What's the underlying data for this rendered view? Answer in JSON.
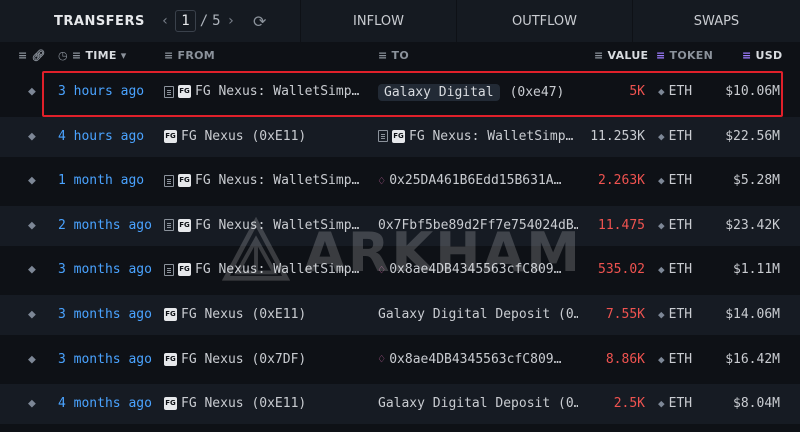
{
  "topbar": {
    "transfers_label": "TRANSFERS",
    "page_current": "1",
    "page_sep": "/",
    "page_total": "5",
    "tabs": [
      "INFLOW",
      "OUTFLOW",
      "SWAPS"
    ]
  },
  "header": {
    "time": "TIME",
    "from": "FROM",
    "to": "TO",
    "value": "VALUE",
    "token": "TOKEN",
    "usd": "USD"
  },
  "rows": [
    {
      "time": "3 hours ago",
      "from_icon": "doc",
      "from": "FG Nexus: WalletSimp…",
      "to_icon": "none",
      "to": "Galaxy Digital",
      "to_extra": "(0xe47)",
      "to_pill": true,
      "value": "5K",
      "value_color": "red",
      "token": "ETH",
      "usd": "$10.06M"
    },
    {
      "time": "4 hours ago",
      "from_icon": "none",
      "from": "FG Nexus (0xE11)",
      "to_icon": "doc",
      "to": "FG Nexus: WalletSimp…",
      "to_extra": "",
      "to_pill": false,
      "value": "11.253K",
      "value_color": "white",
      "token": "ETH",
      "usd": "$22.56M"
    },
    {
      "time": "1 month ago",
      "from_icon": "doc",
      "from": "FG Nexus: WalletSimp…",
      "to_icon": "gem",
      "to": "0x25DA461B6Edd15B631A…",
      "to_extra": "",
      "to_pill": false,
      "value": "2.263K",
      "value_color": "red",
      "token": "ETH",
      "usd": "$5.28M"
    },
    {
      "time": "2 months ago",
      "from_icon": "doc",
      "from": "FG Nexus: WalletSimp…",
      "to_icon": "none",
      "to": "0x7Fbf5be89d2Ff7e754024dB…",
      "to_extra": "",
      "to_pill": false,
      "value": "11.475",
      "value_color": "red",
      "token": "ETH",
      "usd": "$23.42K"
    },
    {
      "time": "3 months ago",
      "from_icon": "doc",
      "from": "FG Nexus: WalletSimp…",
      "to_icon": "gem",
      "to": "0x8ae4DB4345563cfC809…",
      "to_extra": "",
      "to_pill": false,
      "value": "535.02",
      "value_color": "red",
      "token": "ETH",
      "usd": "$1.11M"
    },
    {
      "time": "3 months ago",
      "from_icon": "none",
      "from": "FG Nexus (0xE11)",
      "to_icon": "none",
      "to": "Galaxy Digital Deposit (0…",
      "to_extra": "",
      "to_pill": false,
      "value": "7.55K",
      "value_color": "red",
      "token": "ETH",
      "usd": "$14.06M"
    },
    {
      "time": "3 months ago",
      "from_icon": "none",
      "from": "FG Nexus (0x7DF)",
      "to_icon": "gem",
      "to": "0x8ae4DB4345563cfC809…",
      "to_extra": "",
      "to_pill": false,
      "value": "8.86K",
      "value_color": "red",
      "token": "ETH",
      "usd": "$16.42M"
    },
    {
      "time": "4 months ago",
      "from_icon": "none",
      "from": "FG Nexus (0xE11)",
      "to_icon": "none",
      "to": "Galaxy Digital Deposit (0…",
      "to_extra": "",
      "to_pill": false,
      "value": "2.5K",
      "value_color": "red",
      "token": "ETH",
      "usd": "$8.04M"
    }
  ],
  "badge_text": "FG",
  "watermark": "ARKHAM",
  "colors": {
    "link": "#4aa3ff",
    "negative": "#ef5350",
    "highlight": "#e0202a",
    "accent": "#9d7cff"
  }
}
